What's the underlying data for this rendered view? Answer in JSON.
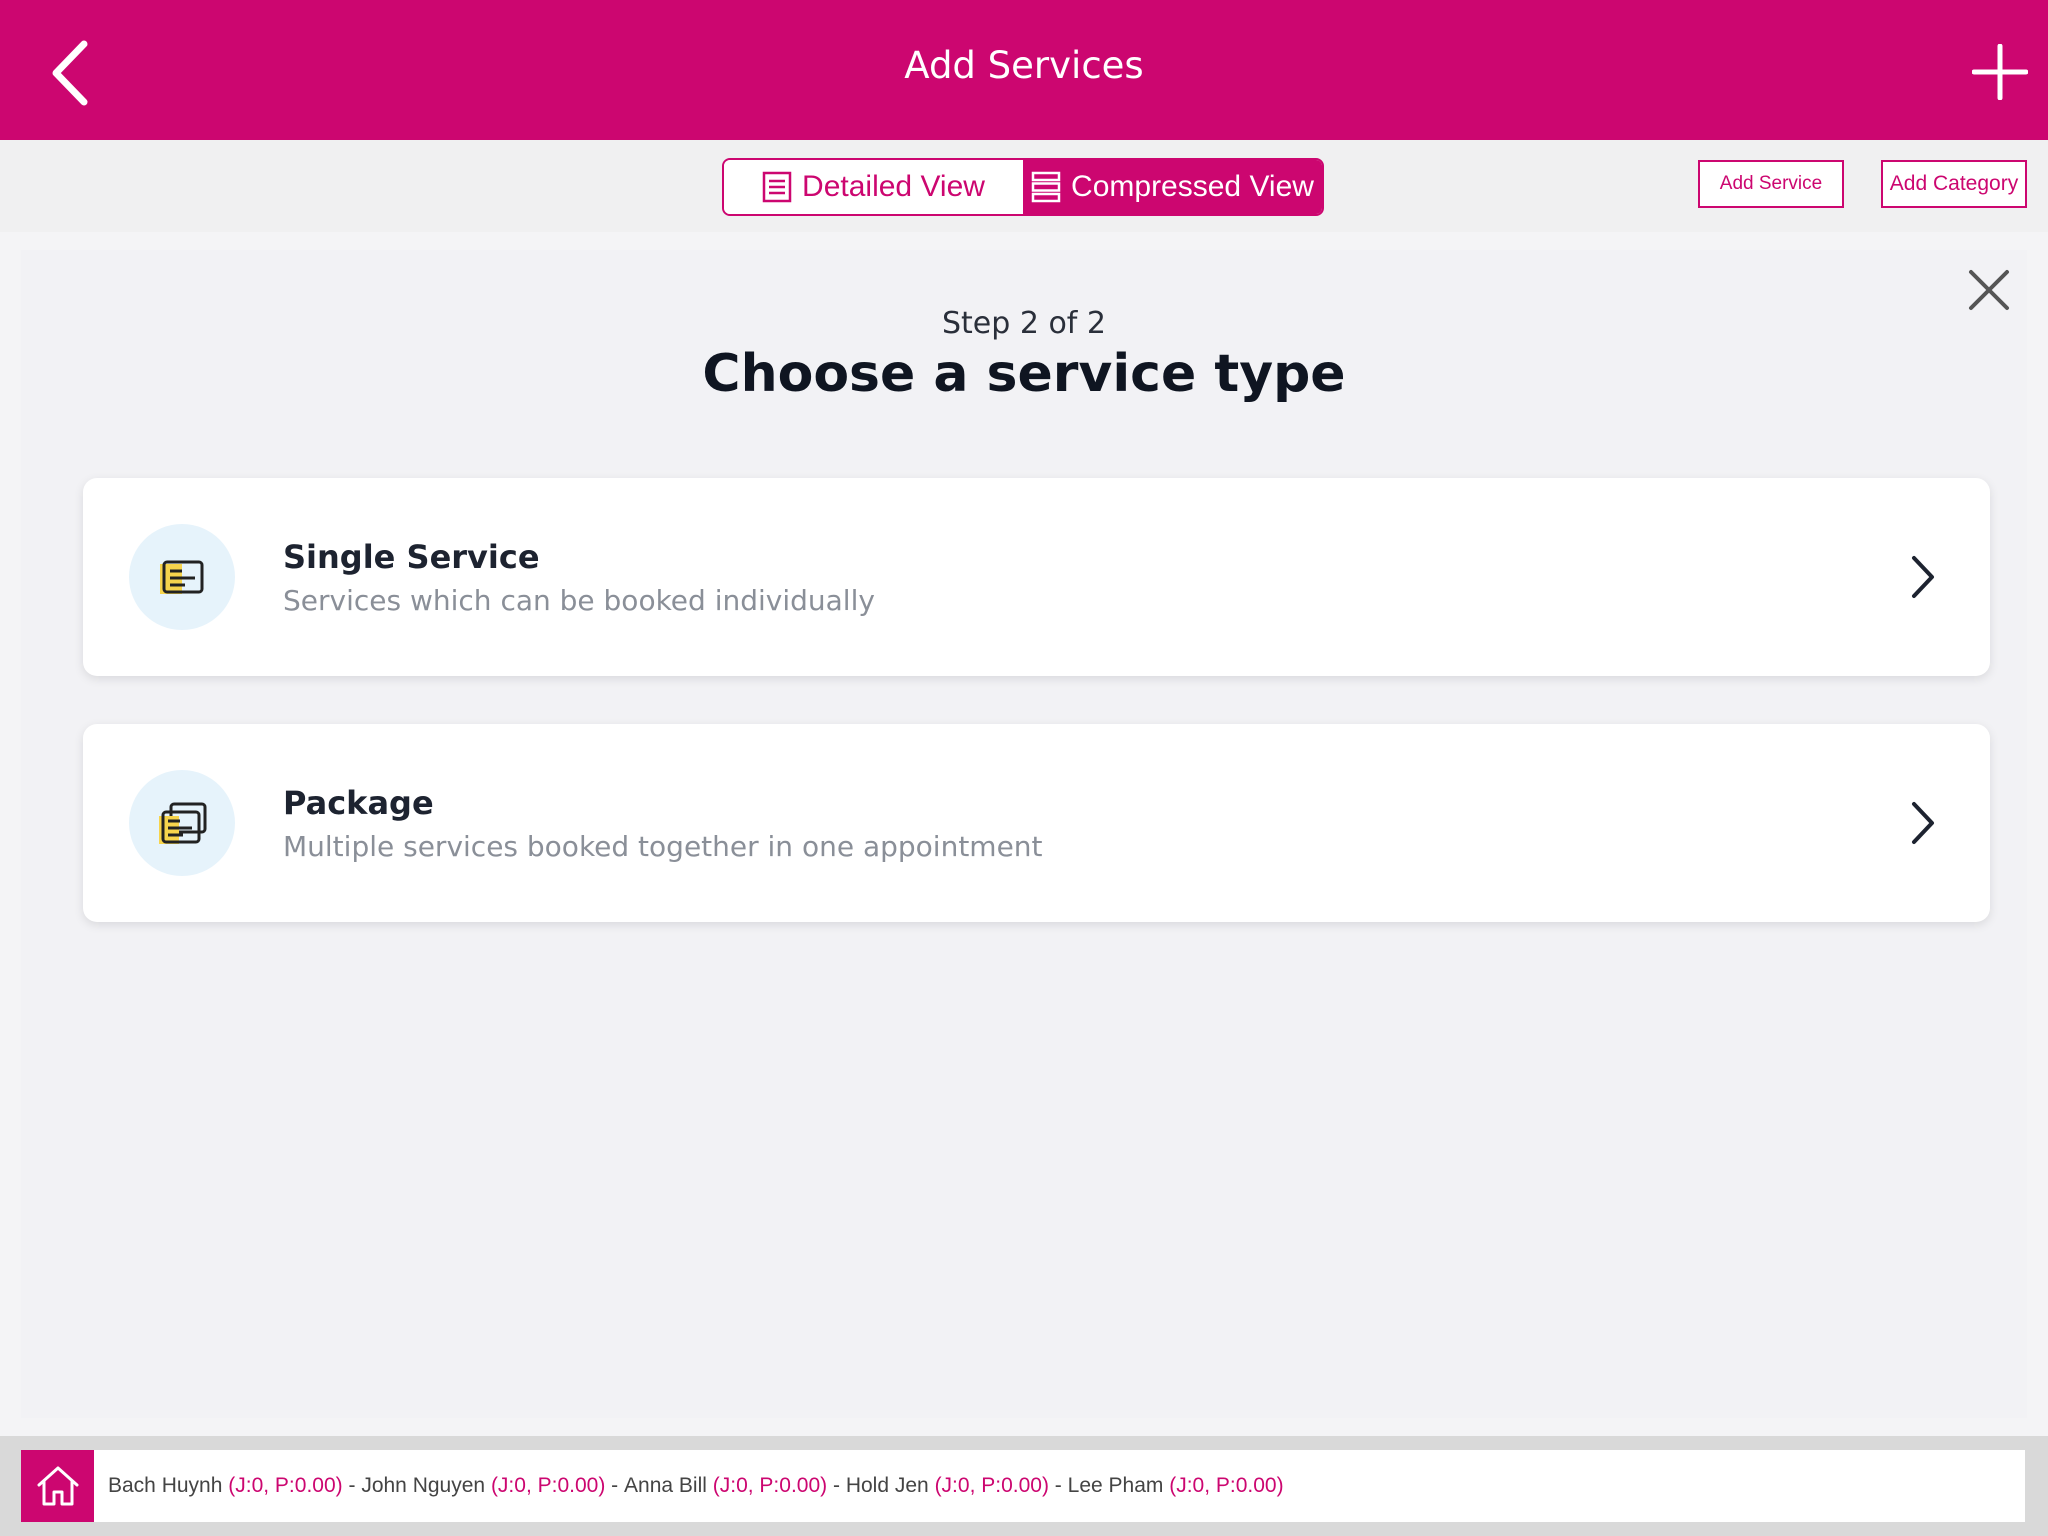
{
  "header": {
    "title": "Add Services",
    "back_icon": "chevron-left-icon",
    "add_icon": "plus-icon"
  },
  "toolbar": {
    "detailed_view_label": "Detailed View",
    "compressed_view_label": "Compressed View",
    "active_view": "Compressed View",
    "add_service_label": "Add Service",
    "add_category_label": "Add Category"
  },
  "modal": {
    "step_text": "Step 2 of 2",
    "heading": "Choose a service type",
    "options": [
      {
        "title": "Single Service",
        "description": "Services which can be booked individually",
        "icon": "single-service-icon"
      },
      {
        "title": "Package",
        "description": "Multiple services booked together in one appointment",
        "icon": "package-icon"
      }
    ]
  },
  "footer": {
    "staff": [
      {
        "name": "Bach Huynh",
        "stats": "(J:0, P:0.00)"
      },
      {
        "name": "John Nguyen",
        "stats": "(J:0, P:0.00)"
      },
      {
        "name": "Anna Bill",
        "stats": "(J:0, P:0.00)"
      },
      {
        "name": "Hold Jen",
        "stats": "(J:0, P:0.00)"
      },
      {
        "name": "Lee Pham",
        "stats": "(J:0, P:0.00)"
      }
    ],
    "separator": "-"
  },
  "colors": {
    "brand": "#cc0670",
    "icon_yellow": "#f7d44c",
    "icon_circle": "#e6f3fb"
  }
}
